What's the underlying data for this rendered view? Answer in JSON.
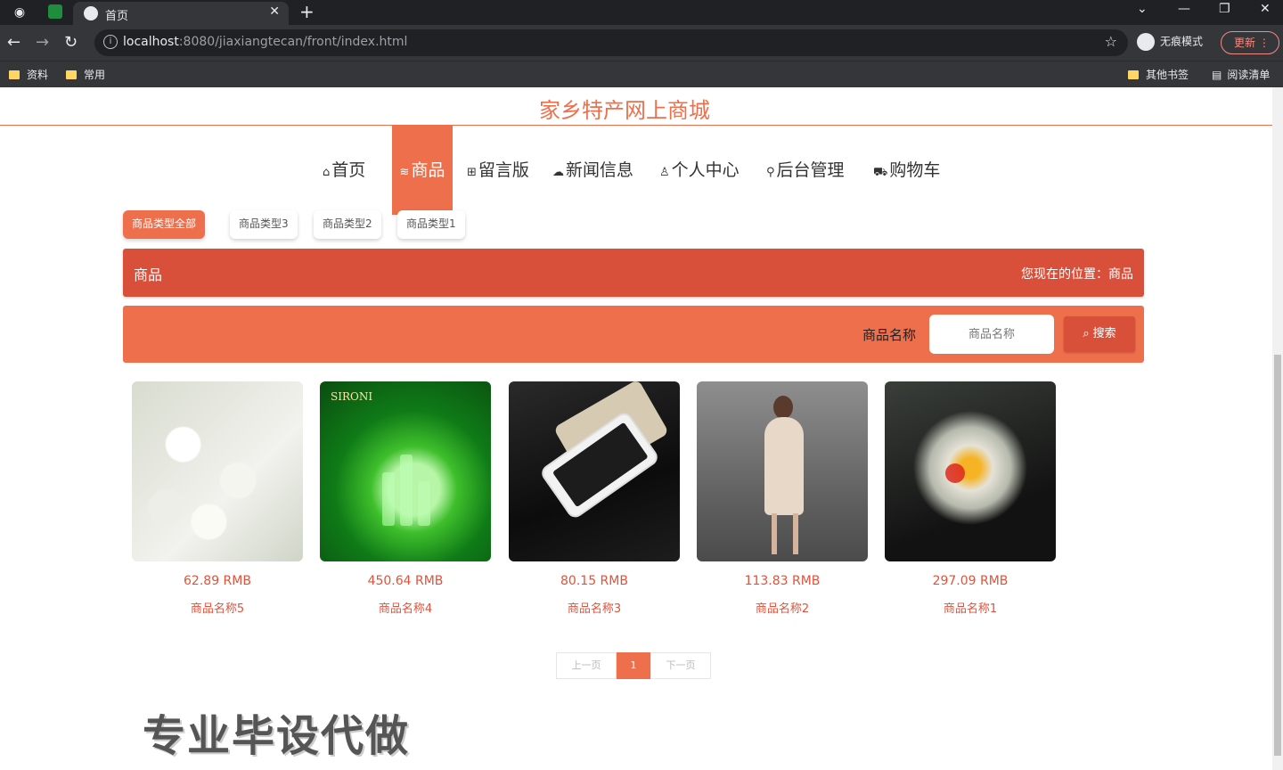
{
  "browser": {
    "tab_title": "首页",
    "url_host": "localhost",
    "url_rest": ":8080/jiaxiangtecan/front/index.html",
    "incognito_label": "无痕模式",
    "update_label": "更新",
    "bookmarks": [
      "资料",
      "常用"
    ],
    "bookmarks_right": [
      "其他书签",
      "阅读清单"
    ]
  },
  "site": {
    "title": "家乡特产网上商城"
  },
  "nav": {
    "items": [
      {
        "icon": "home-icon",
        "label": "首页"
      },
      {
        "icon": "layers-icon",
        "label": "商品"
      },
      {
        "icon": "gift-icon",
        "label": "留言版"
      },
      {
        "icon": "cloud-icon",
        "label": "新闻信息"
      },
      {
        "icon": "user-icon",
        "label": "个人中心"
      },
      {
        "icon": "link-icon",
        "label": "后台管理"
      },
      {
        "icon": "cart-icon",
        "label": "购物车"
      }
    ],
    "active_index": 1
  },
  "types": [
    "商品类型全部",
    "商品类型3",
    "商品类型2",
    "商品类型1"
  ],
  "location": {
    "section": "商品",
    "breadcrumb": "您现在的位置：商品"
  },
  "search": {
    "label": "商品名称",
    "placeholder": "商品名称",
    "button": "搜索"
  },
  "products": [
    {
      "price": "62.89 RMB",
      "name": "商品名称5"
    },
    {
      "price": "450.64 RMB",
      "name": "商品名称4"
    },
    {
      "price": "80.15 RMB",
      "name": "商品名称3"
    },
    {
      "price": "113.83 RMB",
      "name": "商品名称2"
    },
    {
      "price": "297.09 RMB",
      "name": "商品名称1"
    }
  ],
  "pager": {
    "prev": "上一页",
    "current": "1",
    "next": "下一页"
  },
  "overlay_text": "专业毕设代做",
  "colors": {
    "accent": "#ee6f4c",
    "accent_dark": "#d9503a",
    "price": "#e0533b"
  }
}
